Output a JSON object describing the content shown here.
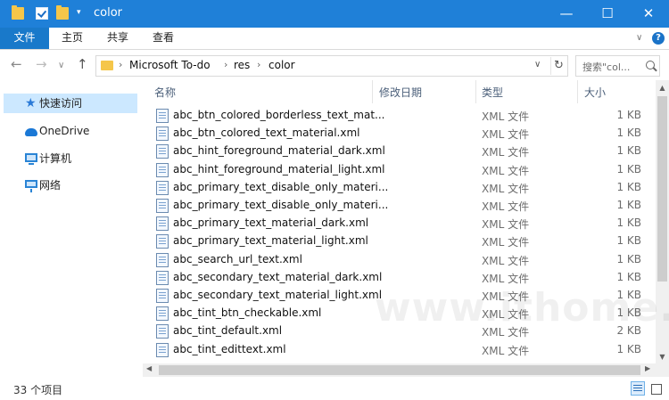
{
  "window": {
    "title": "color",
    "minimize_glyph": "—",
    "maximize_glyph": "☐",
    "close_glyph": "✕"
  },
  "quick_access_toolbar": {
    "separator_glyph": "▾"
  },
  "ribbon": {
    "tabs": [
      "文件",
      "主页",
      "共享",
      "查看"
    ],
    "expand_glyph": "∨",
    "help_glyph": "?"
  },
  "navigation": {
    "back_glyph": "←",
    "forward_glyph": "→",
    "recent_glyph": "∨",
    "up_glyph": "↑",
    "breadcrumb": [
      "Microsoft To-do",
      "res",
      "color"
    ],
    "crumb_separator": "›",
    "dropdown_glyph": "∨",
    "refresh_glyph": "↻",
    "search_placeholder": "搜索\"col..."
  },
  "nav_pane": [
    {
      "label": "快速访问",
      "icon": "star-icon"
    },
    {
      "label": "OneDrive",
      "icon": "cloud-icon"
    },
    {
      "label": "计算机",
      "icon": "computer-icon"
    },
    {
      "label": "网络",
      "icon": "network-icon"
    }
  ],
  "columns": [
    "名称",
    "修改日期",
    "类型",
    "大小"
  ],
  "sort_glyph": "^",
  "files": [
    {
      "name": "abc_btn_colored_borderless_text_mat...",
      "type": "XML 文件",
      "size": "1 KB"
    },
    {
      "name": "abc_btn_colored_text_material.xml",
      "type": "XML 文件",
      "size": "1 KB"
    },
    {
      "name": "abc_hint_foreground_material_dark.xml",
      "type": "XML 文件",
      "size": "1 KB"
    },
    {
      "name": "abc_hint_foreground_material_light.xml",
      "type": "XML 文件",
      "size": "1 KB"
    },
    {
      "name": "abc_primary_text_disable_only_materi...",
      "type": "XML 文件",
      "size": "1 KB"
    },
    {
      "name": "abc_primary_text_disable_only_materi...",
      "type": "XML 文件",
      "size": "1 KB"
    },
    {
      "name": "abc_primary_text_material_dark.xml",
      "type": "XML 文件",
      "size": "1 KB"
    },
    {
      "name": "abc_primary_text_material_light.xml",
      "type": "XML 文件",
      "size": "1 KB"
    },
    {
      "name": "abc_search_url_text.xml",
      "type": "XML 文件",
      "size": "1 KB"
    },
    {
      "name": "abc_secondary_text_material_dark.xml",
      "type": "XML 文件",
      "size": "1 KB"
    },
    {
      "name": "abc_secondary_text_material_light.xml",
      "type": "XML 文件",
      "size": "1 KB"
    },
    {
      "name": "abc_tint_btn_checkable.xml",
      "type": "XML 文件",
      "size": "1 KB"
    },
    {
      "name": "abc_tint_default.xml",
      "type": "XML 文件",
      "size": "2 KB"
    },
    {
      "name": "abc_tint_edittext.xml",
      "type": "XML 文件",
      "size": "1 KB"
    }
  ],
  "scrollbar": {
    "up_glyph": "▲",
    "down_glyph": "▼",
    "left_glyph": "◀",
    "right_glyph": "▶"
  },
  "status": {
    "item_count": "33 个项目"
  },
  "watermark": "www.ithome.com",
  "colors": {
    "title_bar": "#1f80d8",
    "file_tab": "#1979ca",
    "selected_nav": "#cce8ff",
    "header_text": "#4c607a"
  }
}
